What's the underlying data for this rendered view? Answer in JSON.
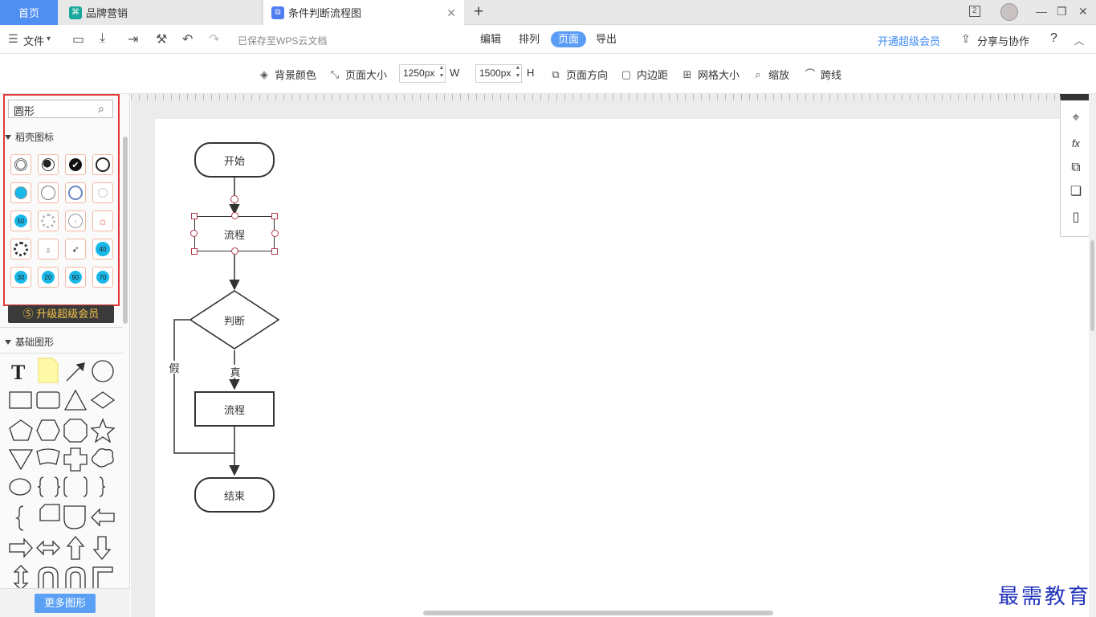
{
  "tabs": {
    "home": "首页",
    "brand": "品牌营销",
    "flow": "条件判断流程图",
    "window_count": "2"
  },
  "menu": {
    "file": "文件",
    "saved_status": "已保存至WPS云文档",
    "modes": [
      "编辑",
      "排列",
      "页面",
      "导出"
    ],
    "active_mode": "页面",
    "vip": "开通超级会员",
    "share": "分享与协作",
    "help": "?"
  },
  "toolbar": {
    "bg_color": "背景颜色",
    "page_size": "页面大小",
    "width_value": "1250px",
    "width_unit": "W",
    "height_value": "1500px",
    "height_unit": "H",
    "page_orientation": "页面方向",
    "padding": "内边距",
    "grid_size": "网格大小",
    "zoom": "缩放",
    "cross_line": "跨线"
  },
  "left_panel": {
    "search_value": "圆形",
    "section_icons": "稻壳图标",
    "badge_numbers": [
      "50",
      "40",
      "30",
      "20",
      "90",
      "70"
    ],
    "upgrade": "升级超级会员",
    "section_basic": "基础图形",
    "more_shapes": "更多图形"
  },
  "flowchart": {
    "start": "开始",
    "process1": "流程",
    "decision": "判断",
    "true_label": "真",
    "false_label": "假",
    "process2": "流程",
    "end": "结束"
  },
  "watermark": "最需教育",
  "colors": {
    "accent": "#4f8ff2",
    "selection": "#b33c4d",
    "highlight_frame": "#e23838",
    "badge_blue": "#1ab8e8"
  }
}
